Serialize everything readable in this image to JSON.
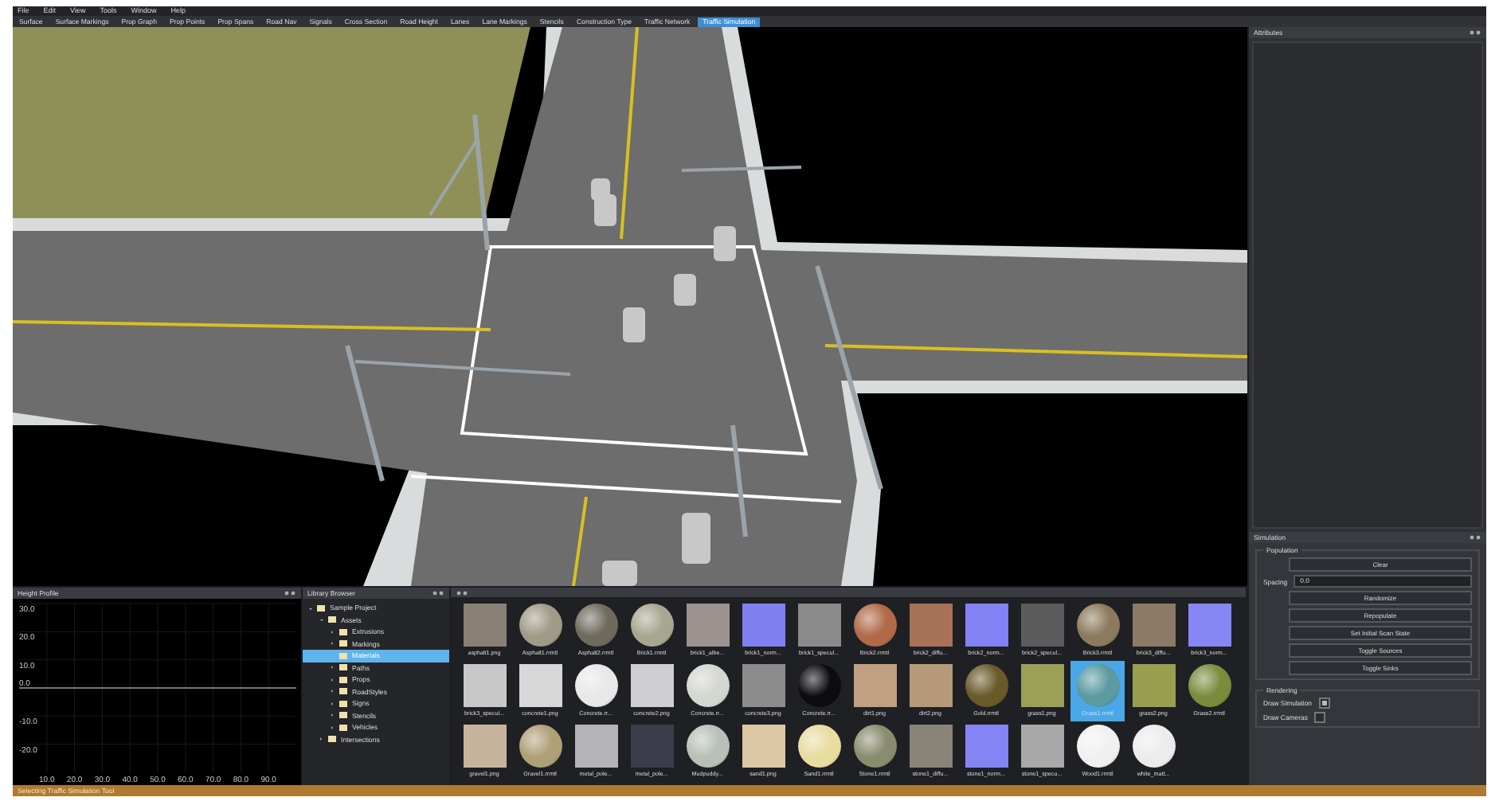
{
  "menu": [
    "File",
    "Edit",
    "View",
    "Tools",
    "Window",
    "Help"
  ],
  "toolbar": [
    {
      "label": "Surface",
      "selected": false
    },
    {
      "label": "Surface Markings",
      "selected": false
    },
    {
      "label": "Prop Graph",
      "selected": false
    },
    {
      "label": "Prop Points",
      "selected": false
    },
    {
      "label": "Prop Spans",
      "selected": false
    },
    {
      "label": "Road Nav",
      "selected": false
    },
    {
      "label": "Signals",
      "selected": false
    },
    {
      "label": "Cross Section",
      "selected": false
    },
    {
      "label": "Road Height",
      "selected": false
    },
    {
      "label": "Lanes",
      "selected": false
    },
    {
      "label": "Lane Markings",
      "selected": false
    },
    {
      "label": "Stencils",
      "selected": false
    },
    {
      "label": "Construction Type",
      "selected": false
    },
    {
      "label": "Traffic Network",
      "selected": false
    },
    {
      "label": "Traffic Simulation",
      "selected": true
    }
  ],
  "attributes": {
    "title": "Attributes"
  },
  "simulation": {
    "title": "Simulation",
    "population": {
      "title": "Population",
      "buttons_top": [
        "Clear"
      ],
      "spacing": {
        "label": "Spacing",
        "value": "0.0"
      },
      "buttons": [
        "Randomize",
        "Repopulate",
        "Set Initial Scan State",
        "Toggle Sources",
        "Toggle Sinks"
      ]
    },
    "rendering": {
      "title": "Rendering",
      "options": [
        {
          "label": "Draw Simulation",
          "checked": true
        },
        {
          "label": "Draw Cameras",
          "checked": false
        }
      ]
    }
  },
  "height_profile": {
    "title": "Height Profile",
    "x_axis_labels": [
      "10.0",
      "20.0",
      "30.0",
      "40.0",
      "50.0",
      "60.0",
      "70.0",
      "80.0",
      "90.0"
    ],
    "y_axis_labels": [
      "30.0",
      "20.0",
      "10.0",
      "0.0",
      "-10.0",
      "-20.0"
    ]
  },
  "library": {
    "title": "Library Browser",
    "tree": [
      {
        "label": "Sample Project",
        "expanded": true,
        "selected": false,
        "children": [
          {
            "label": "Assets",
            "expanded": true,
            "selected": false,
            "children": [
              {
                "label": "Extrusions",
                "expanded": false,
                "selected": false
              },
              {
                "label": "Markings",
                "expanded": false,
                "selected": false
              },
              {
                "label": "Materials",
                "expanded": false,
                "selected": true
              },
              {
                "label": "Paths",
                "expanded": false,
                "selected": false
              },
              {
                "label": "Props",
                "expanded": false,
                "selected": false
              },
              {
                "label": "RoadStyles",
                "expanded": false,
                "selected": false
              },
              {
                "label": "Signs",
                "expanded": false,
                "selected": false
              },
              {
                "label": "Stencils",
                "expanded": false,
                "selected": false
              },
              {
                "label": "Vehicles",
                "expanded": false,
                "selected": false
              }
            ]
          },
          {
            "label": "Intersections",
            "expanded": false,
            "selected": false
          }
        ]
      }
    ]
  },
  "assets": [
    {
      "label": "asphalt1.png",
      "kind": "flat",
      "color": "#8a7f74",
      "selected": false
    },
    {
      "label": "Asphalt1.rrmtl",
      "kind": "sphere",
      "color": "#a09a88",
      "selected": false
    },
    {
      "label": "Asphalt2.rrmtl",
      "kind": "sphere",
      "color": "#6e6a5c",
      "selected": false
    },
    {
      "label": "Brick1.rrmtl",
      "kind": "sphere",
      "color": "#a8a690",
      "selected": false
    },
    {
      "label": "brick1_albe...",
      "kind": "flat",
      "color": "#9c9290",
      "selected": false
    },
    {
      "label": "brick1_norm...",
      "kind": "flat",
      "color": "#8080f0",
      "selected": false
    },
    {
      "label": "brick1_specul...",
      "kind": "flat",
      "color": "#8a8a8a",
      "selected": false
    },
    {
      "label": "Brick2.rrmtl",
      "kind": "sphere",
      "color": "#b06a48",
      "selected": false
    },
    {
      "label": "brick2_diffu...",
      "kind": "flat",
      "color": "#a87258",
      "selected": false
    },
    {
      "label": "brick2_norm...",
      "kind": "flat",
      "color": "#8282f4",
      "selected": false
    },
    {
      "label": "brick2_specul...",
      "kind": "flat",
      "color": "#5c5c5c",
      "selected": false
    },
    {
      "label": "Brick3.rrmtl",
      "kind": "sphere",
      "color": "#8c7a5c",
      "selected": false
    },
    {
      "label": "brick3_diffu...",
      "kind": "flat",
      "color": "#8c7a66",
      "selected": false
    },
    {
      "label": "brick3_norm...",
      "kind": "flat",
      "color": "#8686f4",
      "selected": false
    },
    {
      "label": "brick3_specul...",
      "kind": "flat",
      "color": "#c8c8c8",
      "selected": false
    },
    {
      "label": "concrete1.png",
      "kind": "flat",
      "color": "#d8d8d8",
      "selected": false
    },
    {
      "label": "Concrete.rr...",
      "kind": "sphere",
      "color": "#e8e8e8",
      "selected": false
    },
    {
      "label": "concrete2.png",
      "kind": "flat",
      "color": "#cfcfd2",
      "selected": false
    },
    {
      "label": "Concrete.rr...",
      "kind": "sphere",
      "color": "#d4d6d0",
      "selected": false
    },
    {
      "label": "concrete3.png",
      "kind": "flat",
      "color": "#8c8c8c",
      "selected": false
    },
    {
      "label": "Concrete.rr...",
      "kind": "sphere",
      "color": "#0c0c10",
      "selected": false
    },
    {
      "label": "dirt1.png",
      "kind": "flat",
      "color": "#c0a080",
      "selected": false
    },
    {
      "label": "dirt2.png",
      "kind": "flat",
      "color": "#b49a78",
      "selected": false
    },
    {
      "label": "Gold.rrmtl",
      "kind": "sphere",
      "color": "#6a5a2a",
      "selected": false
    },
    {
      "label": "grass1.png",
      "kind": "flat",
      "color": "#9aa058",
      "selected": false
    },
    {
      "label": "Grass1.rrmtl",
      "kind": "sphere",
      "color": "#5a9aa0",
      "selected": true
    },
    {
      "label": "grass2.png",
      "kind": "flat",
      "color": "#98a050",
      "selected": false
    },
    {
      "label": "Grass2.rrmtl",
      "kind": "sphere",
      "color": "#7a8c3c",
      "selected": false
    },
    {
      "label": "gravel1.png",
      "kind": "flat",
      "color": "#c8b49c",
      "selected": false
    },
    {
      "label": "Gravel1.rrmtl",
      "kind": "sphere",
      "color": "#b0a078",
      "selected": false
    },
    {
      "label": "metal_pole...",
      "kind": "flat",
      "color": "#b4b4b8",
      "selected": false
    },
    {
      "label": "metal_pole...",
      "kind": "flat",
      "color": "#3c3c4c",
      "selected": false
    },
    {
      "label": "Mudpuddy...",
      "kind": "sphere",
      "color": "#b8c0b8",
      "selected": false
    },
    {
      "label": "sand1.png",
      "kind": "flat",
      "color": "#dcc8a4",
      "selected": false
    },
    {
      "label": "Sand1.rrmtl",
      "kind": "sphere",
      "color": "#e8dca0",
      "selected": false
    },
    {
      "label": "Stone1.rrmtl",
      "kind": "sphere",
      "color": "#8a8c70",
      "selected": false
    },
    {
      "label": "stone1_diffu...",
      "kind": "flat",
      "color": "#8a8478",
      "selected": false
    },
    {
      "label": "stone1_norm...",
      "kind": "flat",
      "color": "#8484f4",
      "selected": false
    },
    {
      "label": "stone1_specu...",
      "kind": "flat",
      "color": "#a8a8a8",
      "selected": false
    },
    {
      "label": "Wood1.rrmtl",
      "kind": "sphere",
      "color": "#f0f0f0",
      "selected": false
    },
    {
      "label": "white_matt...",
      "kind": "sphere",
      "color": "#ececec",
      "selected": false
    }
  ],
  "status_bar": "Selecting Traffic Simulation Tool"
}
